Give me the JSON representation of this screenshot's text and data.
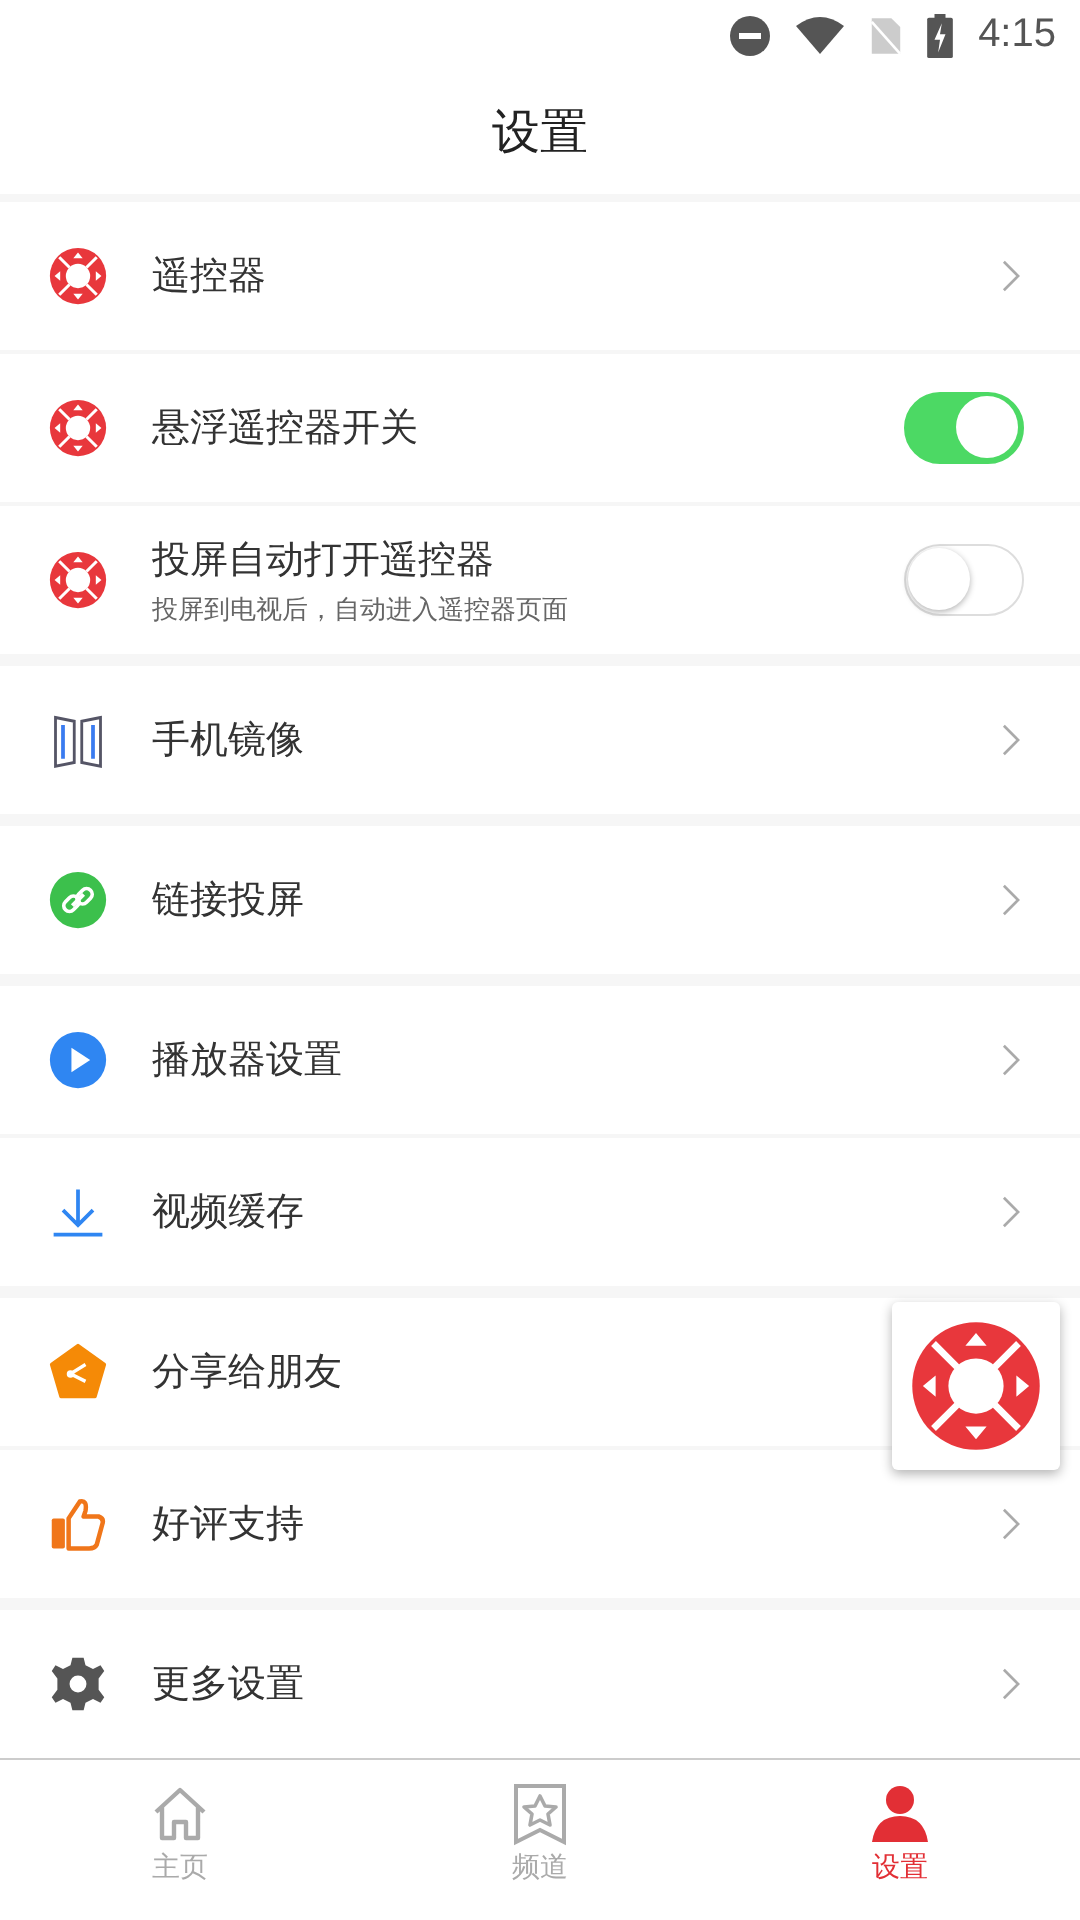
{
  "status_bar": {
    "time": "4:15"
  },
  "header": {
    "title": "设置"
  },
  "groups": [
    {
      "rows": [
        {
          "kind": "link",
          "label": "遥控器"
        },
        {
          "kind": "toggle",
          "label": "悬浮遥控器开关",
          "on": true
        },
        {
          "kind": "toggle",
          "label": "投屏自动打开遥控器",
          "subtitle": "投屏到电视后，自动进入遥控器页面",
          "on": false
        }
      ]
    },
    {
      "rows": [
        {
          "kind": "link",
          "label": "手机镜像"
        }
      ]
    },
    {
      "rows": [
        {
          "kind": "link",
          "label": "链接投屏"
        }
      ]
    },
    {
      "rows": [
        {
          "kind": "link",
          "label": "播放器设置"
        },
        {
          "kind": "link",
          "label": "视频缓存"
        }
      ]
    },
    {
      "rows": [
        {
          "kind": "item",
          "label": "分享给朋友"
        },
        {
          "kind": "link",
          "label": "好评支持"
        }
      ]
    },
    {
      "rows": [
        {
          "kind": "link",
          "label": "更多设置"
        }
      ]
    }
  ],
  "bottom_nav": [
    {
      "label": "主页",
      "selected": false
    },
    {
      "label": "频道",
      "selected": false
    },
    {
      "label": "设置",
      "selected": true
    }
  ]
}
